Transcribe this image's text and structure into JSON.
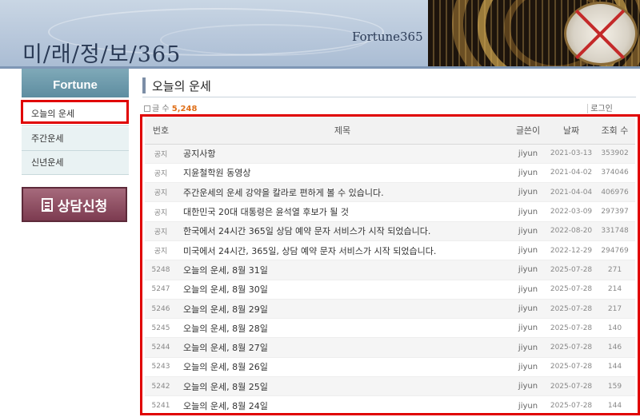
{
  "header": {
    "site_title": "미/래/정/보/365",
    "brand": "Fortune365"
  },
  "sidebar": {
    "heading": "Fortune",
    "items": [
      {
        "label": "오늘의 운세"
      },
      {
        "label": "주간운세"
      },
      {
        "label": "신년운세"
      }
    ],
    "consult_button": "상담신청"
  },
  "main": {
    "title": "오늘의 운세",
    "count_label": "글 수",
    "count_value": "5,248",
    "login_link": "로그인"
  },
  "table": {
    "headers": {
      "num": "번호",
      "title": "제목",
      "author": "글쓴이",
      "date": "날짜",
      "views": "조회 수"
    },
    "rows": [
      {
        "num": "공지",
        "title": "공지사항",
        "author": "jiyun",
        "date": "2021-03-13",
        "views": "353902"
      },
      {
        "num": "공지",
        "title": "지윤철학원 동영상",
        "author": "jiyun",
        "date": "2021-04-02",
        "views": "374046"
      },
      {
        "num": "공지",
        "title": "주간운세의 운세 강약을 칼라로 편하게 볼 수 있습니다.",
        "author": "jiyun",
        "date": "2021-04-04",
        "views": "406976"
      },
      {
        "num": "공지",
        "title": "대한민국 20대 대통령은 윤석열 후보가 될 것",
        "author": "jiyun",
        "date": "2022-03-09",
        "views": "297397"
      },
      {
        "num": "공지",
        "title": "한국에서 24시간 365일 상담 예약 문자 서비스가 시작 되었습니다.",
        "author": "jiyun",
        "date": "2022-08-20",
        "views": "331748"
      },
      {
        "num": "공지",
        "title": "미국에서 24시간, 365일, 상담 예약 문자 서비스가 시작 되었습니다.",
        "author": "jiyun",
        "date": "2022-12-29",
        "views": "294769"
      },
      {
        "num": "5248",
        "title": "오늘의 운세, 8월 31일",
        "author": "jiyun",
        "date": "2025-07-28",
        "views": "271"
      },
      {
        "num": "5247",
        "title": "오늘의 운세, 8월 30일",
        "author": "jiyun",
        "date": "2025-07-28",
        "views": "214"
      },
      {
        "num": "5246",
        "title": "오늘의 운세, 8월 29일",
        "author": "jiyun",
        "date": "2025-07-28",
        "views": "217"
      },
      {
        "num": "5245",
        "title": "오늘의 운세, 8월 28일",
        "author": "jiyun",
        "date": "2025-07-28",
        "views": "140"
      },
      {
        "num": "5244",
        "title": "오늘의 운세, 8월 27일",
        "author": "jiyun",
        "date": "2025-07-28",
        "views": "146"
      },
      {
        "num": "5243",
        "title": "오늘의 운세, 8월 26일",
        "author": "jiyun",
        "date": "2025-07-28",
        "views": "144"
      },
      {
        "num": "5242",
        "title": "오늘의 운세, 8월 25일",
        "author": "jiyun",
        "date": "2025-07-28",
        "views": "159"
      },
      {
        "num": "5241",
        "title": "오늘의 운세, 8월 24일",
        "author": "jiyun",
        "date": "2025-07-28",
        "views": "144"
      }
    ]
  }
}
